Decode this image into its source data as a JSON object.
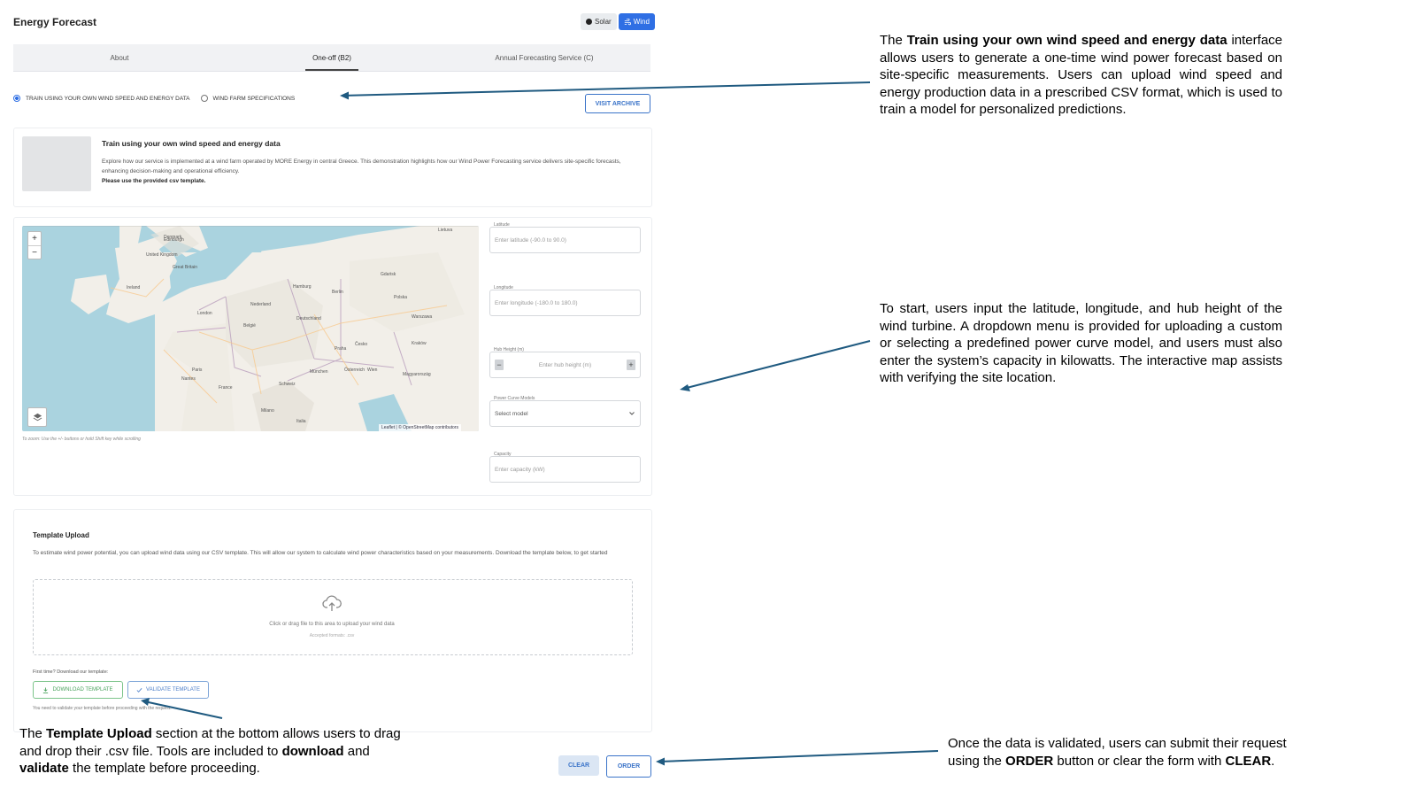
{
  "app": {
    "title": "Energy Forecast",
    "toggle": {
      "solar": "Solar",
      "wind": "Wind",
      "selected": "Wind"
    }
  },
  "tabs": [
    {
      "label": "About",
      "active": false
    },
    {
      "label": "One-off (B2)",
      "active": true
    },
    {
      "label": "Annual Forecasting Service (C)",
      "active": false
    }
  ],
  "mode": {
    "option1": "TRAIN USING YOUR OWN WIND SPEED AND ENERGY DATA",
    "option2": "WIND FARM SPECIFICATIONS",
    "selected": "option1",
    "archive_button": "VISIT ARCHIVE"
  },
  "intro": {
    "title": "Train using your own wind speed and energy data",
    "text": "Explore how our service is implemented at a wind farm operated by MORE Energy in central Greece. This demonstration highlights how our Wind Power Forecasting service delivers site-specific forecasts, enhancing decision-making and operational efficiency.",
    "bold": "Please use the provided csv template."
  },
  "map": {
    "zoom_in": "+",
    "zoom_out": "−",
    "attribution": "Leaflet | © OpenStreetMap contributors",
    "hint": "To zoom: Use the +/- buttons or hold Shift key while scrolling",
    "labels": [
      {
        "text": "Denmark"
      },
      {
        "text": "Edinburgh"
      },
      {
        "text": "United Kingdom"
      },
      {
        "text": "Great Britain"
      },
      {
        "text": "Ireland"
      },
      {
        "text": "London"
      },
      {
        "text": "Nederland"
      },
      {
        "text": "Belgié"
      },
      {
        "text": "Deutschland"
      },
      {
        "text": "Berlin"
      },
      {
        "text": "Polska"
      },
      {
        "text": "Warszawa"
      },
      {
        "text": "Česko"
      },
      {
        "text": "Paris"
      },
      {
        "text": "France"
      },
      {
        "text": "Schweiz"
      },
      {
        "text": "Österreich"
      },
      {
        "text": "Magyarország"
      },
      {
        "text": "Italia"
      },
      {
        "text": "Lietuva"
      },
      {
        "text": "Hamburg"
      },
      {
        "text": "Praha"
      },
      {
        "text": "Wien"
      },
      {
        "text": "Milano"
      },
      {
        "text": "München"
      },
      {
        "text": "Gdańsk"
      },
      {
        "text": "Kraków"
      },
      {
        "text": "Nantes"
      }
    ]
  },
  "form": {
    "latitude_label": "Latitude",
    "latitude_placeholder": "Enter latitude (-90.0 to 90.0)",
    "longitude_label": "Longitude",
    "longitude_placeholder": "Enter longitude (-180.0 to 180.0)",
    "hub_label": "Hub Height (m)",
    "hub_placeholder": "Enter hub height (m)",
    "minus": "−",
    "plus": "+",
    "power_curve_label": "Power Curve Models",
    "power_curve_value": "Select model",
    "capacity_label": "Capacity",
    "capacity_placeholder": "Enter capacity (kW)"
  },
  "upload": {
    "title": "Template Upload",
    "desc": "To estimate wind power potential, you can upload wind data using our CSV template. This will allow our system to calculate wind power characteristics based on your measurements. Download the template below, to get started",
    "drop_text": "Click or drag file to this area to upload your wind data",
    "drop_sub": "Accepted formats: .csv",
    "first_time": "First time? Download our template:",
    "download_btn": "DOWNLOAD TEMPLATE",
    "validate_btn": "VALIDATE TEMPLATE",
    "validate_note": "You need to validate your template before proceeding with the request."
  },
  "actions": {
    "clear": "CLEAR",
    "order": "ORDER"
  },
  "annotations": {
    "a1": {
      "p1": "The ",
      "b1": "Train using your own wind speed and energy data",
      "p2": " interface allows users to generate a one-time wind power forecast based on site-specific measurements. Users can upload wind speed and energy production data in a prescribed CSV format, which is used to train a model for personalized predictions."
    },
    "a2": "To start, users input the latitude, longitude, and hub height of the wind turbine. A dropdown menu is provided for uploading a custom or selecting a predefined power curve model, and users must also enter the system’s capacity in kilowatts. The interactive map assists with verifying the site location.",
    "a3": {
      "p1": "The ",
      "b1": "Template Upload",
      "p2": " section at the bottom allows users to drag and drop their .csv file. Tools are included to ",
      "b2": "download",
      "p3": " and ",
      "b3": "validate",
      "p4": " the template before proceeding."
    },
    "a4": {
      "p1": "Once the data is validated, users can submit their request using the ",
      "b1": "ORDER",
      "p2": " button or clear the form with ",
      "b2": "CLEAR",
      "p3": "."
    }
  },
  "colors": {
    "accent": "#2f6fe4",
    "arrow": "#1f5a80",
    "water": "#aad3df",
    "land": "#f2efe9"
  }
}
